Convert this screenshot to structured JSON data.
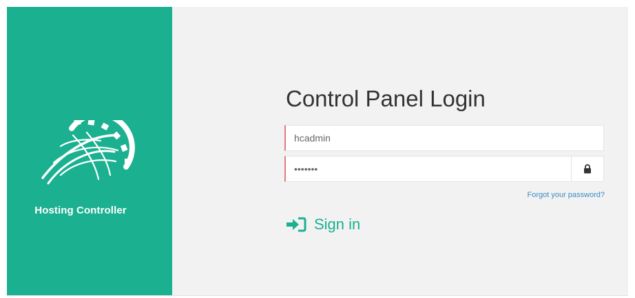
{
  "brand": {
    "name": "Hosting Controller",
    "logo_icon": "globe-gear-icon",
    "color": "#1bb090"
  },
  "login": {
    "title": "Control Panel Login",
    "username_value": "hcadmin",
    "password_value": "•••••••",
    "password_icon": "lock-icon",
    "forgot_label": "Forgot your password?",
    "signin_label": "Sign in",
    "signin_icon": "sign-in-icon",
    "field_accent": "#e07a80",
    "link_color": "#3b8bc4"
  }
}
